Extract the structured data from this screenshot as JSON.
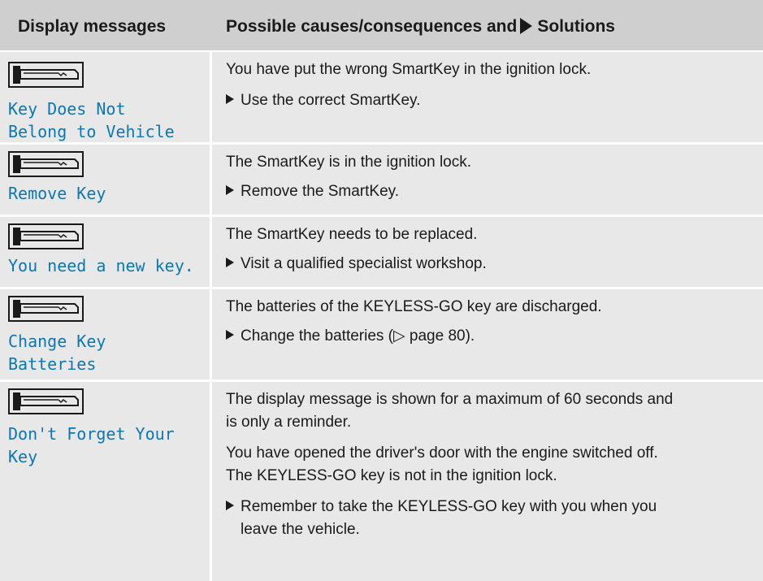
{
  "header": {
    "col1": "Display messages",
    "col2_a": "Possible causes/consequences and",
    "col2_b": "Solutions"
  },
  "rows": [
    {
      "message": "Key Does Not\nBelong to Vehicle",
      "icon": "key-icon",
      "cause": "You have put the wrong SmartKey in the ignition lock.",
      "solution": "Use the correct SmartKey."
    },
    {
      "message": "Remove Key",
      "icon": "key-icon",
      "cause": "The SmartKey is in the ignition lock.",
      "solution": "Remove the SmartKey."
    },
    {
      "message": "You need a new key.",
      "icon": "key-icon",
      "cause": "The SmartKey needs to be replaced.",
      "solution": "Visit a qualified specialist workshop."
    },
    {
      "message": "Change Key\nBatteries",
      "icon": "key-icon",
      "cause": "The batteries of the KEYLESS-GO key are discharged.",
      "solution_a": "Change the batteries (",
      "solution_ref": "▷",
      "solution_b": " page 80)."
    },
    {
      "message": "Don't Forget Your\nKey",
      "icon": "key-icon",
      "cause_1_a": "The display message is shown for a maximum of 60 seconds and",
      "cause_1_b": "is only a reminder.",
      "cause_2_a": "You have opened the driver's door with the engine switched off.",
      "cause_2_b": "The KEYLESS-GO key is not in the ignition lock.",
      "solution_a": "Remember to take the KEYLESS-GO key with you when you",
      "solution_b": "leave the vehicle."
    }
  ],
  "colors": {
    "header_bg": "#cfcfcf",
    "row_bg": "#e8e8e8",
    "message_text": "#0a78b4"
  }
}
